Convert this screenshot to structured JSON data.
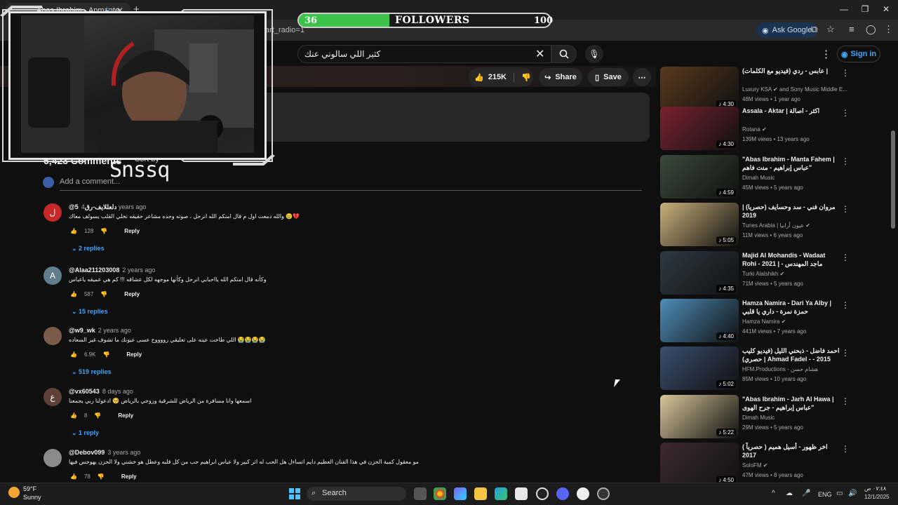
{
  "browser": {
    "tab_title": "Abas Ibrahim - Anmante",
    "url_fragment": "art_radio=1",
    "ask_google_label": "Ask Google"
  },
  "youtube": {
    "search_query": "كثير اللي سالوني عنك",
    "sign_in_label": "Sign in",
    "likes": "215K",
    "share_label": "Share",
    "save_label": "Save"
  },
  "followers_widget": {
    "current": "36",
    "label": "FOLLOWERS",
    "goal": "100",
    "progress_fraction": 0.36,
    "fill_color": "#3cc24a"
  },
  "webcam": {
    "streamer_name": "Snssq"
  },
  "comments_section": {
    "heading": "6,423 Comments",
    "sort_label": "Sort by",
    "add_placeholder": "Add a comment..."
  },
  "comments": [
    {
      "avatar_letter": "ل",
      "avatar_color": "#c62828",
      "author": "@دلعللايف-رق5",
      "time": "4 years ago",
      "text": "والله دمعت اول م قال امتكم الله انرحل ، صوته وحده مشاعر حقيقه تخلي القلب يسولف معاك 😢💔",
      "likes": "128",
      "reply_label": "Reply",
      "replies": "2 replies"
    },
    {
      "avatar_letter": "A",
      "avatar_color": "#607d8b",
      "author": "@Alaa211203008",
      "time": "2 years ago",
      "text": "وكأنه قال امتكم الله يااحبابي انرحل وكأنها موجهه لكل عشاقه !!! كم هي عميقه ياعباس",
      "likes": "587",
      "reply_label": "Reply",
      "replies": "15 replies"
    },
    {
      "avatar_letter": "",
      "avatar_color": "#7a5a48",
      "author": "@w9_wk",
      "time": "2 years ago",
      "text": "اللي طاحت عينه على تعليقي رووووح عسى عيونك ما تشوف غير السعاده 😭😭😭😭",
      "likes": "6.9K",
      "reply_label": "Reply",
      "replies": "519 replies"
    },
    {
      "avatar_letter": "ع",
      "avatar_color": "#5d4037",
      "author": "@vx60543",
      "time": "8 days ago",
      "text": "اسمعها وانا مسافرة من الرياض للشرقية وزوجي بالرياض 🥺 ادعولنا ربي يجمعنا",
      "likes": "8",
      "reply_label": "Reply",
      "replies": "1 reply"
    },
    {
      "avatar_letter": "",
      "avatar_color": "#8a8a8a",
      "author": "@Debov099",
      "time": "3 years ago",
      "text": "مو معقول كمية الحزن في هذا الفنان العظيم دايم اتساءل هل الحب له اثر كبير ولا عباس ابراهيم حب من كل قلبه وعطل هو خشني ولا الحزن يهوجس فيها",
      "likes": "78",
      "reply_label": "Reply",
      "replies": ""
    }
  ],
  "sidebar": [
    {
      "title": "عابس - ردي (فيديو مع الكلمات) |",
      "channel": "Luxury KSA ✔ and Sony Music Middle E...",
      "meta": "48M views • 1 year ago",
      "duration": "4:30",
      "thumb_color": "#5a3a1e"
    },
    {
      "title": "Assala - Aktar | اكثر - اصالة",
      "channel": "Rotana ✔",
      "meta": "139M views • 13 years ago",
      "duration": "4:30",
      "thumb_color": "#7a2230"
    },
    {
      "title": "\"Abas Ibrahim - Manta Fahem | عباس إبراهيم - منت فاهم\"",
      "channel": "Dimah Music",
      "meta": "45M views • 5 years ago",
      "duration": "4:59",
      "thumb_color": "#3a4a3a"
    },
    {
      "title": "مروان فني - سد وحسايف (حصريا) | 2019",
      "channel": "Tunes Arabia | عيون أرابيا ✔",
      "meta": "11M views • 6 years ago",
      "duration": "5:05",
      "thumb_color": "#c9b07a"
    },
    {
      "title": "Majid Al Mohandis - Wadaat Rohi - 2021 | ماجد المهندس - ودعت...",
      "channel": "Turki Alalshikh ✔",
      "meta": "71M views • 5 years ago",
      "duration": "4:35",
      "thumb_color": "#2e3a44"
    },
    {
      "title": "Hamza Namira - Dari Ya Alby | حمزة نمرة - داري يا قلبي",
      "channel": "Hamza Namira ✔",
      "meta": "441M views • 7 years ago",
      "duration": "4:40",
      "thumb_color": "#4f8db8"
    },
    {
      "title": "احمد فاضل - ذبحني الليل (فيديو كليب حصري) | Ahmad Fadel - - 2015",
      "channel": "HFM.Productions - هشام حسن",
      "meta": "85M views • 10 years ago",
      "duration": "5:02",
      "thumb_color": "#3a4f70"
    },
    {
      "title": "\"Abas Ibrahim - Jarh Al Hawa | عباس إبراهيم - جرح الهوى\"",
      "channel": "Dimah Music",
      "meta": "29M views • 5 years ago",
      "duration": "5:22",
      "thumb_color": "#d8c69a"
    },
    {
      "title": "اخر ظهور - أسيل هميم ( حصرياً ) 2017",
      "channel": "SoloFM ✔",
      "meta": "47M views • 8 years ago",
      "duration": "4:50",
      "thumb_color": "#3d2a30"
    }
  ],
  "taskbar": {
    "temperature": "59°F",
    "condition": "Sunny",
    "search_label": "Search",
    "lang": "ENG",
    "time": "٠٧:٤٨ ص",
    "date": "12/1/2025"
  }
}
